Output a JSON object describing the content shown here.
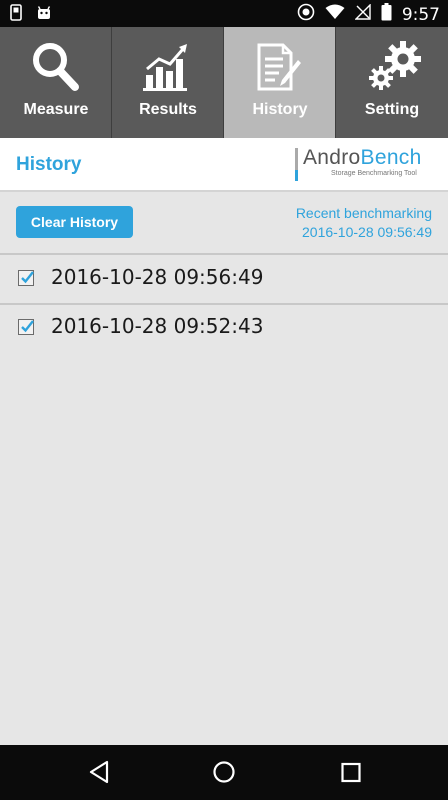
{
  "status_bar": {
    "time": "9:57",
    "icons": [
      "notification-icon",
      "android-icon",
      "sync-icon",
      "wifi-icon",
      "no-signal-icon",
      "battery-icon"
    ]
  },
  "tabs": [
    {
      "label": "Measure",
      "icon": "search-icon",
      "active": false
    },
    {
      "label": "Results",
      "icon": "bar-chart-icon",
      "active": false
    },
    {
      "label": "History",
      "icon": "document-edit-icon",
      "active": true
    },
    {
      "label": "Setting",
      "icon": "gears-icon",
      "active": false
    }
  ],
  "header": {
    "title": "History",
    "logo": {
      "part1": "Andro",
      "part2": "Bench",
      "tagline": "Storage Benchmarking Tool"
    }
  },
  "actions": {
    "clear_label": "Clear History"
  },
  "recent": {
    "label": "Recent benchmarking",
    "timestamp": "2016-10-28 09:56:49"
  },
  "history": [
    {
      "timestamp": "2016-10-28 09:56:49",
      "checked": true
    },
    {
      "timestamp": "2016-10-28 09:52:43",
      "checked": true
    }
  ],
  "colors": {
    "accent": "#2fa3dc",
    "tab_bg": "#5a5a5a",
    "tab_active": "#b9b9b9",
    "page_bg": "#e6e6e6"
  },
  "nav": [
    "back-icon",
    "home-icon",
    "recents-icon"
  ]
}
